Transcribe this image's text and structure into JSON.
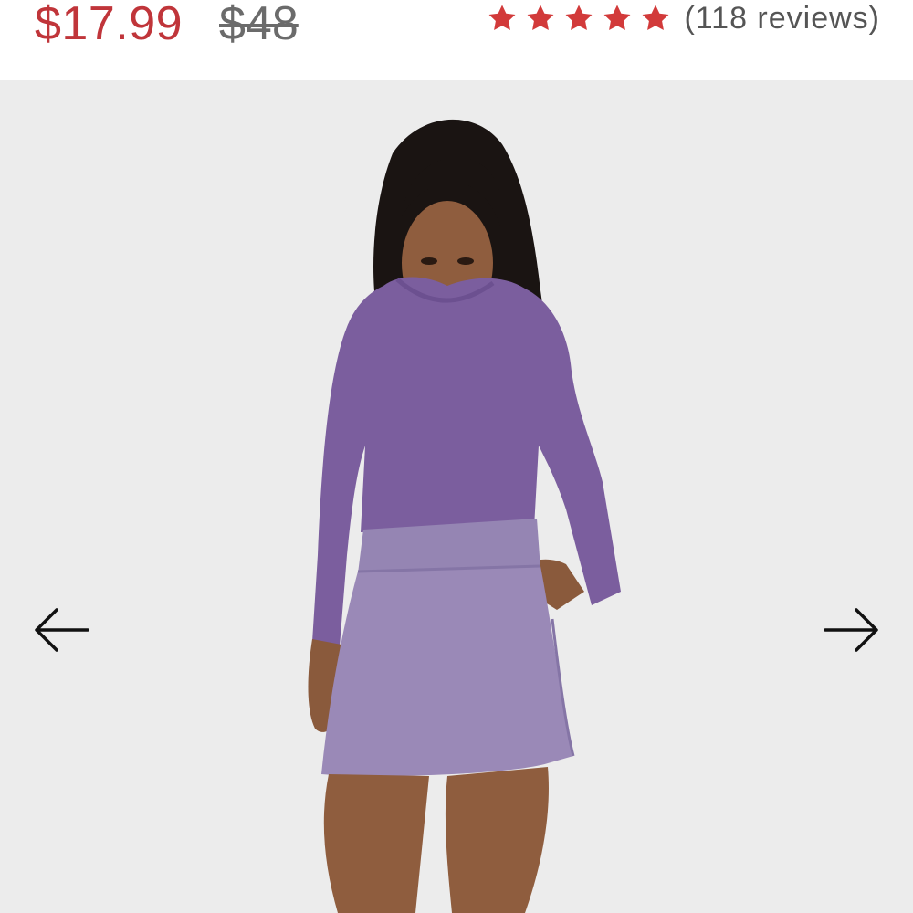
{
  "price": {
    "sale": "$17.99",
    "original": "$48"
  },
  "rating": {
    "stars": 5,
    "review_count_label": "(118 reviews)"
  },
  "gallery": {
    "prev_icon": "arrow-left-icon",
    "next_icon": "arrow-right-icon"
  },
  "colors": {
    "sale_price": "#c0353a",
    "star": "#d23a3a",
    "background": "#ececec",
    "top_color": "#7b5e9e",
    "skirt_color": "#9585b3"
  }
}
